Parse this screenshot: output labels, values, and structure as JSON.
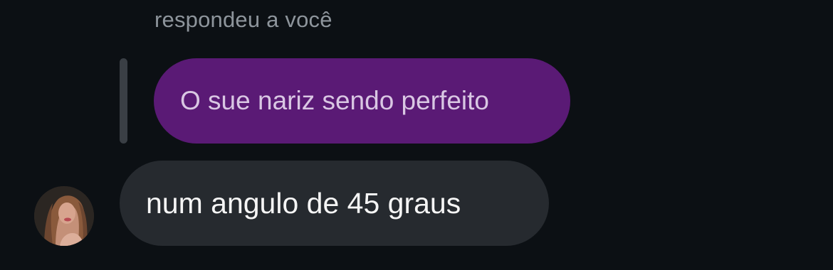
{
  "reply_header": {
    "label": "respondeu a você"
  },
  "quoted_message": {
    "text": "O sue nariz sendo perfeito",
    "bubble_color": "#5a1a75",
    "text_color": "#d9c7e3"
  },
  "message": {
    "text": "num angulo de 45 graus",
    "bubble_color": "#262a2f",
    "text_color": "#f5f5f5"
  },
  "sender": {
    "avatar_icon": "profile-photo"
  },
  "theme": {
    "background": "#0c1014",
    "muted_text": "#8e959c",
    "reply_bar": "#3a3f45"
  }
}
